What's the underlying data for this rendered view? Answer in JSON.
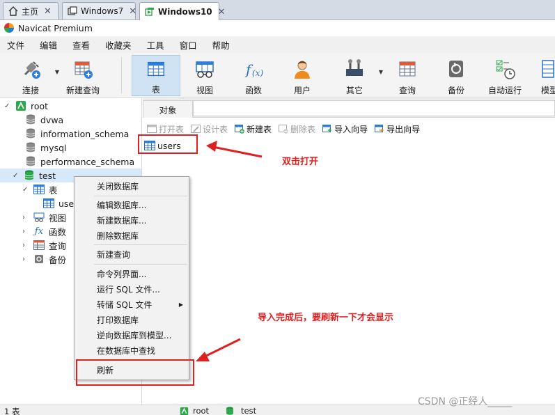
{
  "vm_tabs": [
    {
      "label": "主页",
      "icon": "home-icon"
    },
    {
      "label": "Windows7",
      "icon": "vm-icon"
    },
    {
      "label": "Windows10",
      "icon": "vm-icon",
      "active": true
    }
  ],
  "app_title": "Navicat Premium",
  "menu": [
    "文件",
    "编辑",
    "查看",
    "收藏夹",
    "工具",
    "窗口",
    "帮助"
  ],
  "toolbar": [
    {
      "label": "连接",
      "icon": "connection-plug-icon",
      "dropdown": true
    },
    {
      "label": "新建查询",
      "icon": "new-query-icon"
    },
    {
      "label": "表",
      "icon": "table-icon",
      "active": true
    },
    {
      "label": "视图",
      "icon": "view-icon"
    },
    {
      "label": "函数",
      "icon": "function-icon"
    },
    {
      "label": "用户",
      "icon": "user-icon"
    },
    {
      "label": "其它",
      "icon": "tools-icon",
      "dropdown": true
    },
    {
      "label": "查询",
      "icon": "query-icon"
    },
    {
      "label": "备份",
      "icon": "backup-icon"
    },
    {
      "label": "自动运行",
      "icon": "auto-run-icon"
    },
    {
      "label": "模型",
      "icon": "model-icon"
    }
  ],
  "tree": {
    "root": "root",
    "databases": [
      "dvwa",
      "information_schema",
      "mysql",
      "performance_schema",
      "test"
    ],
    "test_children": {
      "tables_label": "表",
      "table_item": "users",
      "views_label": "视图",
      "functions_label": "函数",
      "queries_label": "查询",
      "backups_label": "备份"
    }
  },
  "object_tab": "对象",
  "object_tools": [
    {
      "label": "打开表",
      "enabled": false
    },
    {
      "label": "设计表",
      "enabled": false
    },
    {
      "label": "新建表",
      "enabled": true
    },
    {
      "label": "删除表",
      "enabled": false
    },
    {
      "label": "导入向导",
      "enabled": true
    },
    {
      "label": "导出向导",
      "enabled": true
    }
  ],
  "object_items": [
    "users"
  ],
  "context_menu": {
    "groups": [
      [
        "关闭数据库"
      ],
      [
        "编辑数据库...",
        "新建数据库...",
        "删除数据库"
      ],
      [
        "新建查询"
      ],
      [
        "命令列界面...",
        "运行 SQL 文件...",
        "转储 SQL 文件",
        "打印数据库",
        "逆向数据库到模型...",
        "在数据库中查找"
      ],
      [
        "刷新"
      ]
    ],
    "submenu_item": "转储 SQL 文件"
  },
  "annotations": {
    "double_click": "双击打开",
    "refresh_note": "导入完成后，要刷新一下才会显示"
  },
  "status": {
    "left": "1 表",
    "connection": "root",
    "database": "test"
  },
  "watermark": "CSDN @正经人_____",
  "colors": {
    "accent_red": "#e02020",
    "toolbar_active": "#cfe3f5",
    "db_green": "#2aa84a"
  }
}
